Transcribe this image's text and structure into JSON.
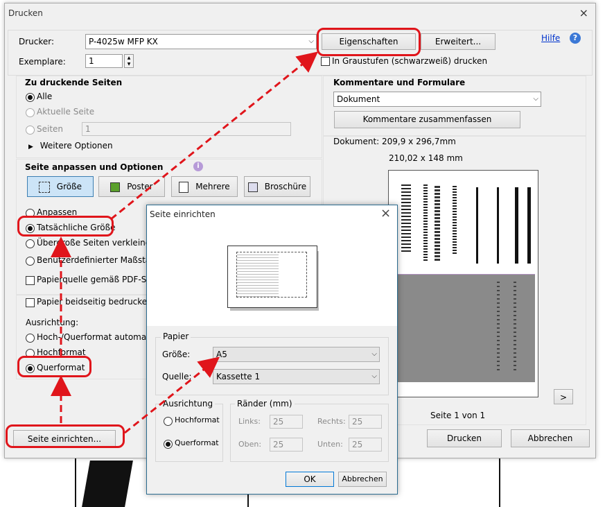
{
  "main": {
    "title": "Drucken",
    "close": "×",
    "printer_label": "Drucker:",
    "printer_value": "P-4025w MFP KX",
    "properties_btn": "Eigenschaften",
    "advanced_btn": "Erweitert...",
    "help": "Hilfe",
    "help_icon": "?",
    "copies_label": "Exemplare:",
    "copies_value": "1",
    "grayscale": "In Graustufen (schwarzweiß) drucken",
    "pages_title": "Zu druckende Seiten",
    "all": "Alle",
    "current": "Aktuelle Seite",
    "pages": "Seiten",
    "pages_value": "1",
    "more_options": "Weitere Optionen",
    "fit_title": "Seite anpassen und Optionen",
    "size_btn": "Größe",
    "poster_btn": "Poster",
    "multi_btn": "Mehrere",
    "booklet_btn": "Broschüre",
    "fit": "Anpassen",
    "actual": "Tatsächliche Größe",
    "shrink": "Übergroße Seiten verkleinern",
    "custom": "Benutzerdefinierter Maßstab:",
    "paper_source": "Papierquelle gemäß PDF-Seite",
    "duplex": "Papier beidseitig bedrucken",
    "orientation": "Ausrichtung:",
    "auto": "Hoch-/Querformat automatisch",
    "portrait": "Hochformat",
    "landscape": "Querformat",
    "page_setup_btn": "Seite einrichten...",
    "comments_title": "Kommentare und Formulare",
    "comments_value": "Dokument",
    "summarize_btn": "Kommentare zusammenfassen",
    "doc_size": "Dokument: 209,9 x 296,7mm",
    "paper_size": "210,02 x 148 mm",
    "next_btn": ">",
    "page_of": "Seite 1 von 1",
    "print_btn": "Drucken",
    "cancel_btn": "Abbrechen"
  },
  "setup": {
    "title": "Seite einrichten",
    "close": "×",
    "paper_group": "Papier",
    "size_label": "Größe:",
    "size_value": "A5",
    "source_label": "Quelle:",
    "source_value": "Kassette 1",
    "orient_group": "Ausrichtung",
    "portrait": "Hochformat",
    "landscape": "Querformat",
    "margins_group": "Ränder (mm)",
    "left_label": "Links:",
    "left_value": "25",
    "right_label": "Rechts:",
    "right_value": "25",
    "top_label": "Oben:",
    "top_value": "25",
    "bottom_label": "Unten:",
    "bottom_value": "25",
    "ok_btn": "OK",
    "cancel_btn": "Abbrechen"
  },
  "colors": {
    "highlight": "#e0151b",
    "accent": "#0066cc"
  }
}
